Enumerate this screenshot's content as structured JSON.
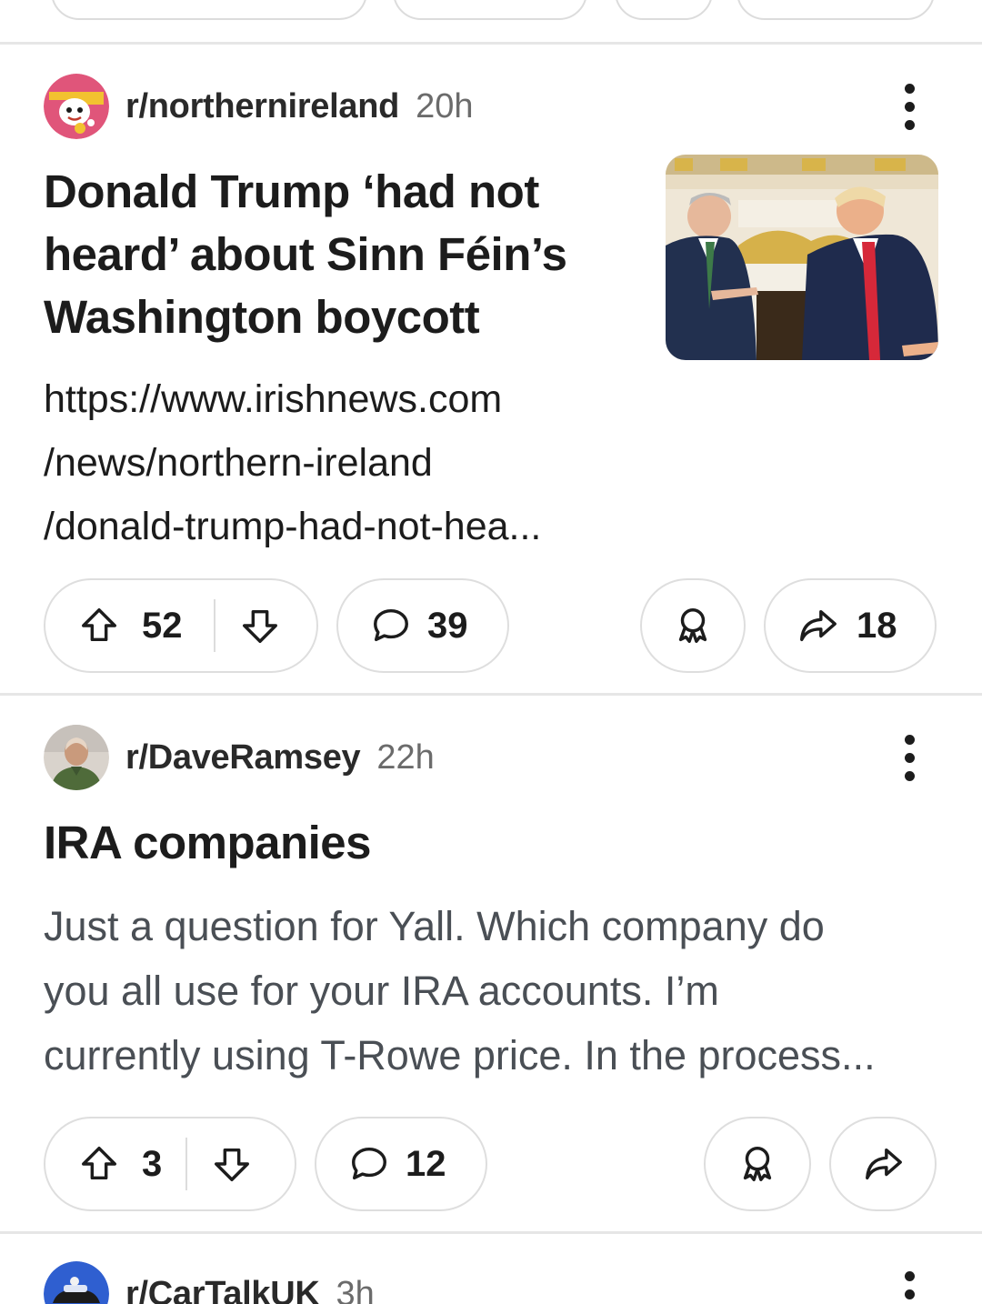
{
  "posts": [
    {
      "subreddit": "r/northernireland",
      "time": "20h",
      "title_lines": [
        "Donald Trump ‘had not",
        "heard’ about Sinn Féin’s",
        "Washington boycott"
      ],
      "link_lines": [
        "https://www.irishnews.com",
        "/news/northern-ireland",
        "/donald-trump-had-not-hea..."
      ],
      "upvotes": "52",
      "comments": "39",
      "shares": "18",
      "avatar_icon": "northernireland-snoo-avatar",
      "thumbnail": "oval-office-meeting-photo"
    },
    {
      "subreddit": "r/DaveRamsey",
      "time": "22h",
      "title": "IRA companies",
      "body_lines": [
        "Just a question for Yall. Which company do",
        "you all use for your IRA accounts. I’m",
        "currently using T-Rowe price. In the process..."
      ],
      "upvotes": "3",
      "comments": "12",
      "avatar_icon": "daveramsey-portrait-avatar"
    },
    {
      "subreddit": "r/CarTalkUK",
      "time": "3h",
      "avatar_icon": "cartalkuk-car-avatar"
    }
  ],
  "icons": {
    "upvote": "arrow-up-icon",
    "downvote": "arrow-down-icon",
    "comment": "speech-bubble-icon",
    "award": "award-ribbon-icon",
    "share": "share-arrow-icon",
    "more": "more-vertical-icon"
  },
  "colors": {
    "text": "#1c1c1c",
    "muted": "#6b6b6b",
    "body": "#4a4f55",
    "border": "#dedede"
  }
}
